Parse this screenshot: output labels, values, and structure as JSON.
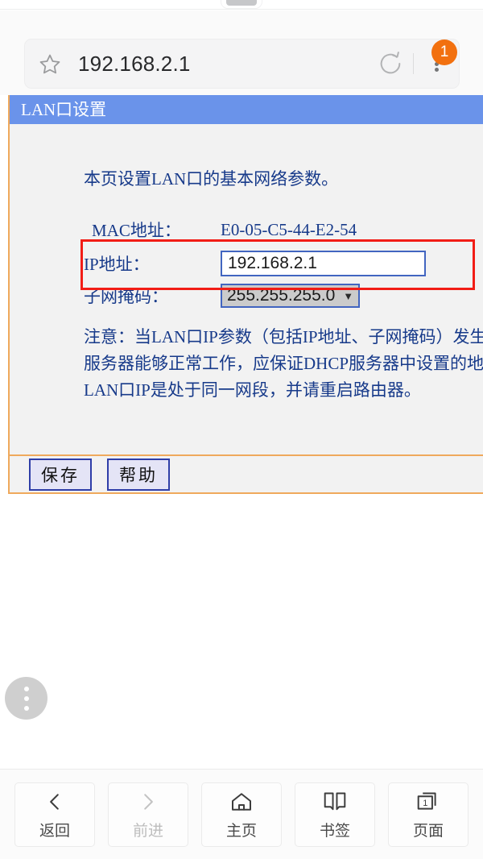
{
  "browser": {
    "url": "192.168.2.1",
    "star_icon": "star-outline-icon",
    "reload_icon": "reload-icon",
    "menu_icon": "kebab-menu-icon",
    "menu_badge_count": "1"
  },
  "page": {
    "panel_title": "LAN口设置",
    "intro": "本页设置LAN口的基本网络参数。",
    "fields": {
      "mac_label": "MAC地址：",
      "mac_value": "E0-05-C5-44-E2-54",
      "ip_label": "IP地址：",
      "ip_value": "192.168.2.1",
      "mask_label": "子网掩码：",
      "mask_value": "255.255.255.0",
      "mask_caret": "▼"
    },
    "notice_lines": [
      "注意：当LAN口IP参数（包括IP地址、子网掩码）发生",
      "服务器能够正常工作，应保证DHCP服务器中设置的地",
      "LAN口IP是处于同一网段，并请重启路由器。"
    ],
    "buttons": {
      "save": "保存",
      "help": "帮助"
    },
    "fab_icon": "kebab-menu-icon"
  },
  "bottom_nav": [
    {
      "label": "返回",
      "icon": "chevron-left-icon",
      "enabled": true
    },
    {
      "label": "前进",
      "icon": "chevron-right-icon",
      "enabled": false
    },
    {
      "label": "主页",
      "icon": "home-icon",
      "enabled": true
    },
    {
      "label": "书签",
      "icon": "book-icon",
      "enabled": true
    },
    {
      "label": "页面",
      "icon": "tabs-icon",
      "enabled": true,
      "badge": "1"
    }
  ],
  "colors": {
    "panel_header_blue": "#6a93ea",
    "panel_border_orange": "#efa95c",
    "annotation_red": "#f21d16",
    "badge_orange": "#f2700f",
    "text_blue": "#173a8a",
    "input_border_blue": "#4265c0"
  }
}
